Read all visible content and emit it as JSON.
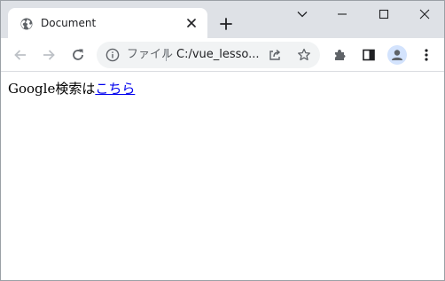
{
  "tab": {
    "title": "Document",
    "favicon": "globe-icon"
  },
  "window_controls": {
    "icons": [
      "chevron-down-icon",
      "minimize-icon",
      "maximize-icon",
      "close-icon"
    ]
  },
  "toolbar": {
    "icons": [
      "back-arrow-icon",
      "forward-arrow-icon",
      "reload-icon",
      "extensions-icon",
      "side-panel-icon",
      "profile-icon",
      "menu-icon"
    ]
  },
  "omnibox": {
    "scheme_label": "ファイル",
    "url": "C:/vue_lesso..."
  },
  "page": {
    "text": "Google検索は",
    "link": "こちら"
  },
  "colors": {
    "tabstrip": "#dee1e6",
    "omnibox": "#f1f3f4",
    "link": "#0000ee",
    "icon": "#5f6368"
  }
}
